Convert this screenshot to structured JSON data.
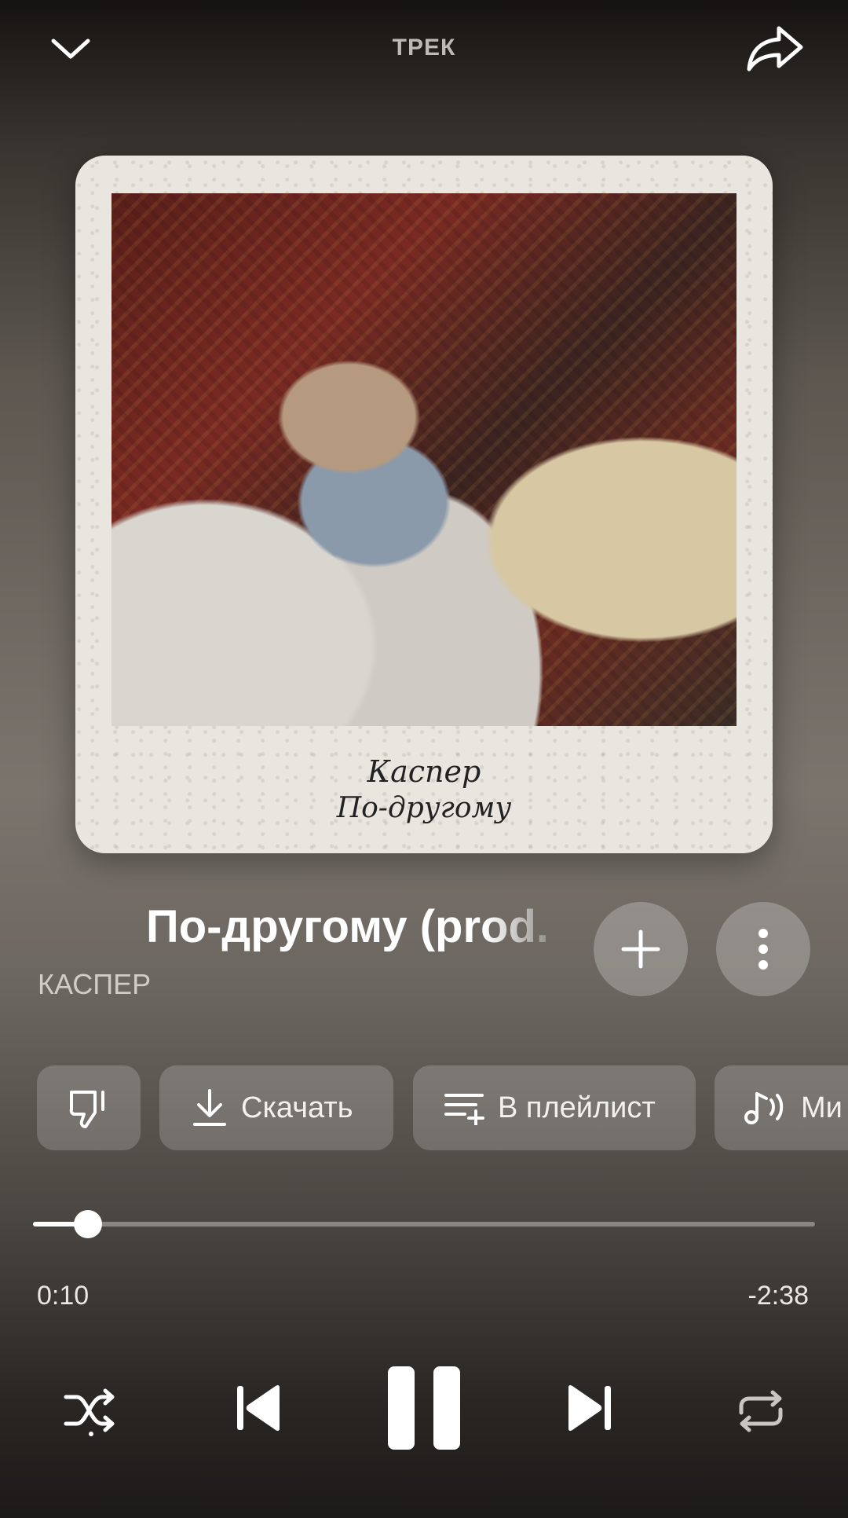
{
  "header": {
    "title": "ТРЕК",
    "collapse_icon": "chevron-down-icon",
    "share_icon": "share-arrow-icon"
  },
  "cover": {
    "artist_handwriting": "Каспер",
    "album_handwriting": "По-другому"
  },
  "track": {
    "title": "По-другому (prod.",
    "artist": "КАСПЕР"
  },
  "actions": {
    "dislike_icon": "thumbs-down-icon",
    "download_label": "Скачать",
    "playlist_label": "В плейлист",
    "mix_label": "Ми"
  },
  "playback": {
    "elapsed": "0:10",
    "remaining": "-2:38",
    "progress": 0.07,
    "state": "playing"
  },
  "colors": {
    "background_top": "#151311",
    "background_mid": "#7b746d",
    "chip_bg": "rgba(255,255,255,0.18)",
    "progress_fill": "#ffffff"
  }
}
